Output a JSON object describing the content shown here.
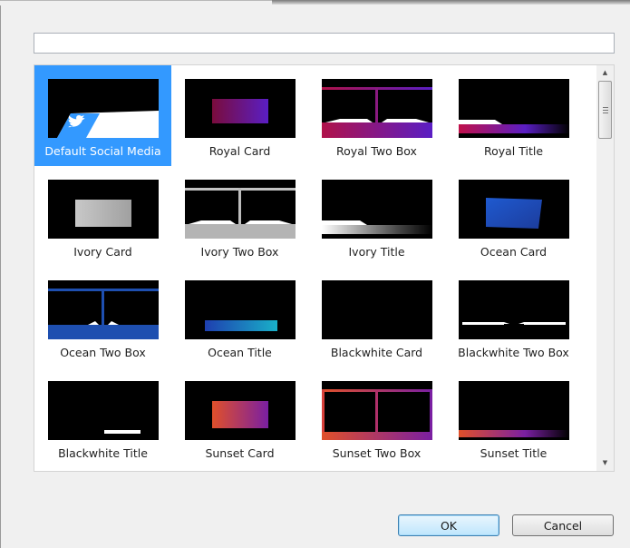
{
  "search": {
    "value": "",
    "placeholder": ""
  },
  "grid": {
    "items": [
      {
        "label": "Default Social Media",
        "selected": true
      },
      {
        "label": "Royal Card"
      },
      {
        "label": "Royal Two Box"
      },
      {
        "label": "Royal Title"
      },
      {
        "label": "Ivory Card"
      },
      {
        "label": "Ivory Two Box"
      },
      {
        "label": "Ivory Title"
      },
      {
        "label": "Ocean Card"
      },
      {
        "label": "Ocean Two Box"
      },
      {
        "label": "Ocean Title"
      },
      {
        "label": "Blackwhite Card"
      },
      {
        "label": "Blackwhite Two Box"
      },
      {
        "label": "Blackwhite Title"
      },
      {
        "label": "Sunset Card"
      },
      {
        "label": "Sunset Two Box"
      },
      {
        "label": "Sunset Title"
      }
    ]
  },
  "colors": {
    "selection": "#3399ff",
    "royal": "#7a1fa2",
    "ivory": "#d0d0d0",
    "ocean": "#1e4fb0",
    "sunset": "#e0502a"
  },
  "scrollbar": {
    "up_icon": "▲",
    "down_icon": "▼"
  },
  "buttons": {
    "ok": "OK",
    "cancel": "Cancel"
  }
}
